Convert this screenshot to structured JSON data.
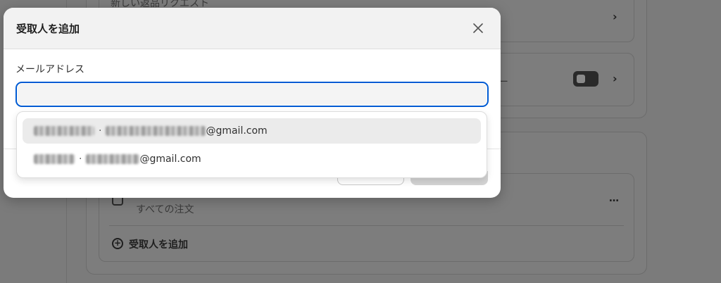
{
  "background": {
    "top_row_text": "新しい返品リクエスト",
    "row2_suffix": "ー",
    "order_row_text": "すべての注文",
    "add_recipient_link": "受取人を追加",
    "more_icon": "…"
  },
  "modal": {
    "title": "受取人を追加",
    "email_label": "メールアドレス",
    "email_value": "",
    "suggestions": [
      {
        "domain": "@gmail.com"
      },
      {
        "domain": "@gmail.com"
      }
    ]
  },
  "colors": {
    "focus_border": "#005bd3",
    "overlay": "#7b7b7b"
  }
}
